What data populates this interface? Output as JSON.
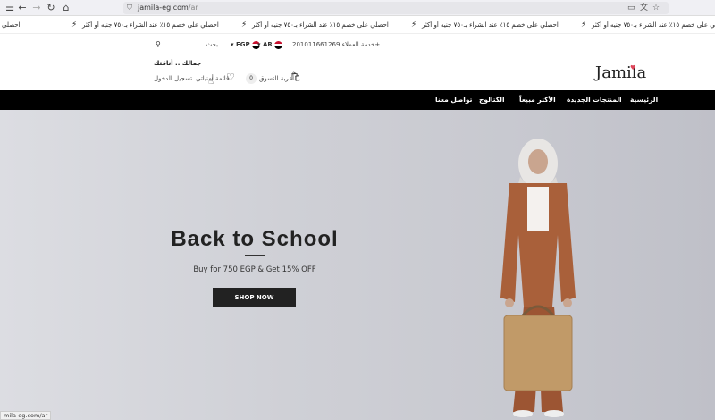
{
  "browser": {
    "url_domain": "jamila-eg.com",
    "url_path": "/ar",
    "status_url": "mila-eg.com/ar"
  },
  "announcement": {
    "items": [
      "احصلي",
      "احصلي على خصم ١٥٪ عند الشراء بـ٧٥٠ جنيه أو أكثر",
      "احصلي على خصم ١٥٪ عند الشراء بـ٧٥٠ جنيه أو أكثر",
      "احصلي على خصم ١٥٪ عند الشراء بـ٧٥٠ جنيه أو أكثر",
      "احصلي على خصم ١٥٪ عند الشراء بـ٧٥٠ جنيه أو أكثر"
    ]
  },
  "header": {
    "search_placeholder": "بحث",
    "currency": "EGP",
    "language": "AR",
    "customer_service": "خدمة العملاء 201011661269+",
    "welcome": "جمالك .. أناقتك",
    "login": "تسجيل الدخول",
    "wishlist": "قائمة أمنياتي",
    "cart_count": "0",
    "cart_label": "عربة التسوق",
    "logo": "Jamila"
  },
  "nav": {
    "items": [
      "الرئيسية",
      "المنتجات الجديدة",
      "الأكثر مبيعاً",
      "الكتالوج",
      "تواصل معنا"
    ]
  },
  "hero": {
    "title": "Back to School",
    "subtitle": "Buy for 750 EGP & Get 15% OFF",
    "button": "SHOP NOW"
  },
  "colors": {
    "nav_bg": "#000000",
    "hero_bg": "#cfd0d6",
    "button_bg": "#222222",
    "logo_heart": "#e0455a",
    "flag_red": "#c8102e"
  },
  "icons": [
    "back-arrow-icon",
    "forward-arrow-icon",
    "reload-icon",
    "home-icon",
    "shield-icon",
    "bolt-icon",
    "search-icon",
    "heart-icon",
    "bag-icon"
  ]
}
